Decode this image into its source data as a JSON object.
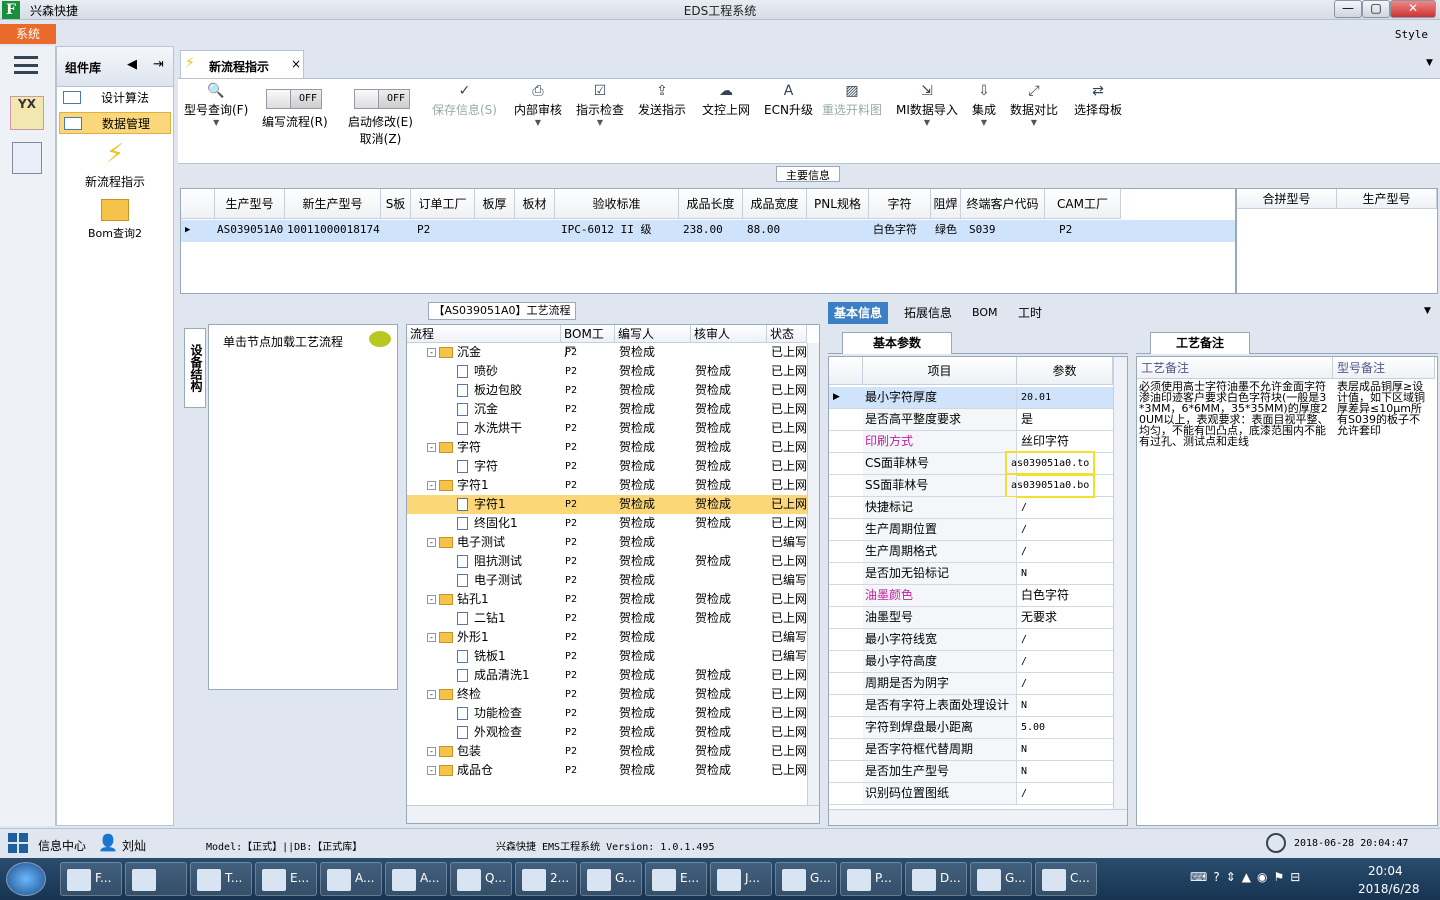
{
  "titlebar": {
    "app": "兴森快捷",
    "window": "EDS工程系统",
    "min": "—",
    "max": "▢",
    "close": "✕"
  },
  "menubar": {
    "system": "系统",
    "style": "Style"
  },
  "nav": {
    "header": "组件库",
    "items": [
      {
        "label": "设计算法"
      },
      {
        "label": "数据管理"
      }
    ],
    "big": [
      {
        "label": "新流程指示"
      },
      {
        "label": "Bom查询2"
      }
    ]
  },
  "doctab": {
    "label": "新流程指示",
    "close": "×"
  },
  "ribbon": {
    "buttons": [
      {
        "label": "型号查询(F)"
      },
      {
        "label": "编写流程(R)",
        "toggle": "OFF"
      },
      {
        "label": "启动修改(E)",
        "label2": "取消(Z)",
        "toggle": "OFF"
      },
      {
        "label": "保存信息(S)"
      },
      {
        "label": "内部审核"
      },
      {
        "label": "指示检查"
      },
      {
        "label": "发送指示"
      },
      {
        "label": "文控上网"
      },
      {
        "label": "ECN升级"
      },
      {
        "label": "重选开料图"
      },
      {
        "label": "MI数据导入"
      },
      {
        "label": "集成"
      },
      {
        "label": "数据对比"
      },
      {
        "label": "选择母板"
      }
    ]
  },
  "main_header": "主要信息",
  "grid": {
    "headers": [
      "生产型号",
      "新生产型号",
      "S板",
      "订单工厂",
      "板厚",
      "板材",
      "验收标准",
      "成品长度",
      "成品宽度",
      "PNL规格",
      "字符",
      "阻焊",
      "终端客户代码",
      "CAM工厂"
    ],
    "row": [
      "AS039051A0",
      "10011000018174",
      "",
      "P2",
      "",
      "",
      "IPC-6012 II 级",
      "238.00",
      "88.00",
      "",
      "白色字符",
      "绿色",
      "S039",
      "P2"
    ],
    "side_headers": [
      "合拼型号",
      "生产型号"
    ]
  },
  "process": {
    "title": "【AS039051A0】工艺流程",
    "vtab": "设备结构",
    "hint": "单击节点加载工艺流程",
    "headers": [
      "流程",
      "BOM工厂",
      "编写人",
      "核审人",
      "状态"
    ],
    "rows": [
      {
        "name": "沉金",
        "plant": "P2",
        "author": "贺检成",
        "reviewer": "",
        "status": "已上网",
        "level": 0,
        "type": "folder"
      },
      {
        "name": "喷砂",
        "plant": "P2",
        "author": "贺检成",
        "reviewer": "贺检成",
        "status": "已上网",
        "level": 1
      },
      {
        "name": "板边包胶",
        "plant": "P2",
        "author": "贺检成",
        "reviewer": "贺检成",
        "status": "已上网",
        "level": 1
      },
      {
        "name": "沉金",
        "plant": "P2",
        "author": "贺检成",
        "reviewer": "贺检成",
        "status": "已上网",
        "level": 1
      },
      {
        "name": "水洗烘干",
        "plant": "P2",
        "author": "贺检成",
        "reviewer": "贺检成",
        "status": "已上网",
        "level": 1
      },
      {
        "name": "字符",
        "plant": "P2",
        "author": "贺检成",
        "reviewer": "贺检成",
        "status": "已上网",
        "level": 0,
        "type": "folder"
      },
      {
        "name": "字符",
        "plant": "P2",
        "author": "贺检成",
        "reviewer": "贺检成",
        "status": "已上网",
        "level": 1
      },
      {
        "name": "字符1",
        "plant": "P2",
        "author": "贺检成",
        "reviewer": "贺检成",
        "status": "已上网",
        "level": 0,
        "type": "folder"
      },
      {
        "name": "字符1",
        "plant": "P2",
        "author": "贺检成",
        "reviewer": "贺检成",
        "status": "已上网",
        "level": 1,
        "sel": true
      },
      {
        "name": "终固化1",
        "plant": "P2",
        "author": "贺检成",
        "reviewer": "贺检成",
        "status": "已上网",
        "level": 1
      },
      {
        "name": "电子测试",
        "plant": "P2",
        "author": "贺检成",
        "reviewer": "",
        "status": "已编写",
        "level": 0,
        "type": "folder"
      },
      {
        "name": "阻抗测试",
        "plant": "P2",
        "author": "贺检成",
        "reviewer": "贺检成",
        "status": "已上网",
        "level": 1
      },
      {
        "name": "电子测试",
        "plant": "P2",
        "author": "贺检成",
        "reviewer": "",
        "status": "已编写",
        "level": 1
      },
      {
        "name": "钻孔1",
        "plant": "P2",
        "author": "贺检成",
        "reviewer": "贺检成",
        "status": "已上网",
        "level": 0,
        "type": "folder"
      },
      {
        "name": "二钻1",
        "plant": "P2",
        "author": "贺检成",
        "reviewer": "贺检成",
        "status": "已上网",
        "level": 1
      },
      {
        "name": "外形1",
        "plant": "P2",
        "author": "贺检成",
        "reviewer": "",
        "status": "已编写",
        "level": 0,
        "type": "folder"
      },
      {
        "name": "铣板1",
        "plant": "P2",
        "author": "贺检成",
        "reviewer": "",
        "status": "已编写",
        "level": 1
      },
      {
        "name": "成品清洗1",
        "plant": "P2",
        "author": "贺检成",
        "reviewer": "贺检成",
        "status": "已上网",
        "level": 1
      },
      {
        "name": "终检",
        "plant": "P2",
        "author": "贺检成",
        "reviewer": "贺检成",
        "status": "已上网",
        "level": 0,
        "type": "folder"
      },
      {
        "name": "功能检查",
        "plant": "P2",
        "author": "贺检成",
        "reviewer": "贺检成",
        "status": "已上网",
        "level": 1
      },
      {
        "name": "外观检查",
        "plant": "P2",
        "author": "贺检成",
        "reviewer": "贺检成",
        "status": "已上网",
        "level": 1
      },
      {
        "name": "包装",
        "plant": "P2",
        "author": "贺检成",
        "reviewer": "贺检成",
        "status": "已上网",
        "level": 0,
        "type": "folder"
      },
      {
        "name": "成品仓",
        "plant": "P2",
        "author": "贺检成",
        "reviewer": "贺检成",
        "status": "已上网",
        "level": 0,
        "type": "folder"
      }
    ]
  },
  "right": {
    "tabs": [
      "基本信息",
      "拓展信息",
      "BOM",
      "工时"
    ],
    "params_title": "基本参数",
    "remarks_title": "工艺备注",
    "params_headers": [
      "项目",
      "参数"
    ],
    "params": [
      {
        "k": "最小字符厚度",
        "v": "20.01"
      },
      {
        "k": "是否高平整度要求",
        "v": "是"
      },
      {
        "k": "印刷方式",
        "v": "丝印字符",
        "hl": true
      },
      {
        "k": "CS面菲林号",
        "v": "as039051a0.to"
      },
      {
        "k": "SS面菲林号",
        "v": "as039051a0.bo"
      },
      {
        "k": "快捷标记",
        "v": "/"
      },
      {
        "k": "生产周期位置",
        "v": "/"
      },
      {
        "k": "生产周期格式",
        "v": "/"
      },
      {
        "k": "是否加无铅标记",
        "v": "N"
      },
      {
        "k": "油墨颜色",
        "v": "白色字符",
        "hl": true
      },
      {
        "k": "油墨型号",
        "v": "无要求"
      },
      {
        "k": "最小字符线宽",
        "v": "/"
      },
      {
        "k": "最小字符高度",
        "v": "/"
      },
      {
        "k": "周期是否为阴字",
        "v": "/"
      },
      {
        "k": "是否有字符上表面处理设计",
        "v": "N"
      },
      {
        "k": "字符到焊盘最小距离",
        "v": "5.00"
      },
      {
        "k": "是否字符框代替周期",
        "v": "N"
      },
      {
        "k": "是否加生产型号",
        "v": "N"
      },
      {
        "k": "识别码位置图纸",
        "v": "/"
      }
    ],
    "remark_headers": [
      "工艺备注",
      "型号备注"
    ],
    "remark_text": "必须使用高士字符油墨不允许金面字符渗油印迹客户要求白色字符块(一般是3*3MM，6*6MM，35*35MM)的厚度20UM以上，表观要求：表面目视平整、均匀，不能有凹凸点，底漆范围内不能有过孔、测试点和走线",
    "model_text": "表层成品铜厚≥设计值，如下区域铜厚差异≤10μm所有S039的板子不允许套印"
  },
  "status": {
    "info": "信息中心",
    "user": "刘灿",
    "model": "Model:【正式】||DB:【正式库】",
    "version": "兴森快捷 EMS工程系统 Version: 1.0.1.495",
    "datetime": "2018-06-28 20:04:47"
  },
  "taskbar": {
    "items": [
      "F...",
      "",
      "T...",
      "E...",
      "A...",
      "A...",
      "Q...",
      "2...",
      "G...",
      "E...",
      "J...",
      "G...",
      "P...",
      "D...",
      "G...",
      "C..."
    ],
    "time": "20:04",
    "date": "2018/6/28"
  }
}
